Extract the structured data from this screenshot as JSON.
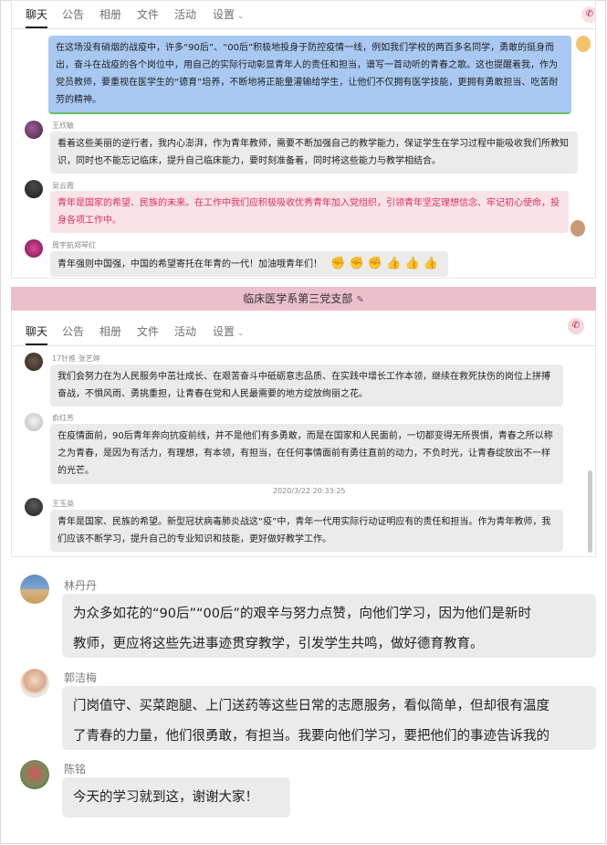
{
  "panel1": {
    "tabs": [
      "聊天",
      "公告",
      "相册",
      "文件",
      "活动",
      "设置"
    ],
    "messages": [
      {
        "name": "",
        "text": "在这场没有硝烟的战疫中，许多“90后”、“00后”积极地投身于防控疫情一线，例如我们学校的两百多名同学，勇敢的挺身而出，奋斗在战疫的各个岗位中，用自己的实际行动彰显青年人的责任和担当，谱写一首动听的青春之歌。这也提醒着我，作为党员教师，要重视在医学生的“德育”培养，不断地将正能量灌输给学生，让他们不仅拥有医学技能，更拥有勇敢担当、吃苦耐劳的精神。"
      },
      {
        "name": "王欣敏",
        "text": "看着这些美丽的逆行者，我内心澎湃，作为青年教师，需要不断加强自己的教学能力，保证学生在学习过程中能吸收我们所教知识，同时也不能忘记临床，提升自己临床能力，要时刻准备着，同时将这些能力与教学相结合。"
      },
      {
        "name": "吴云霞",
        "text": "青年是国家的希望、民族的未来。在工作中我们应积极吸收优秀青年加入党组织，引领青年坚定理想信念、牢记初心使命，投身各项工作中。"
      },
      {
        "name": "周宇航郑琴红",
        "text": "青年强则中国强，中国的希望寄托在年青的一代！加油哦青年们！"
      }
    ]
  },
  "panel2": {
    "title": "临床医学系第三党支部",
    "tabs": [
      "聊天",
      "公告",
      "相册",
      "文件",
      "活动",
      "设置"
    ],
    "timestamp": "2020/3/22 20:33:25",
    "messages": [
      {
        "name": "17针推 张艺婷",
        "text": "我们会努力在为人民服务中茁壮成长、在艰苦奋斗中砥砺意志品质、在实践中增长工作本领，继续在救死扶伤的岗位上拼搏奋战，不惧风雨、勇挑重担，让青春在党和人民最需要的地方绽放绚丽之花。"
      },
      {
        "name": "俞红芳",
        "text": "在疫情面前，90后青年奔向抗疫前线，并不是他们有多勇敢，而是在国家和人民面前，一切都变得无所畏惧，青春之所以称之为青春，是因为有活力，有理想，有本领，有担当，在任何事情面前有勇往直前的动力，不负时光，让青春绽放出不一样的光芒。"
      },
      {
        "name": "王玉英",
        "text": "青年是国家、民族的希望。新型冠状病毒肺炎战这“疫”中，青年一代用实际行动证明应有的责任和担当。作为青年教师，我们应该不断学习，提升自己的专业知识和技能，更好做好教学工作。"
      }
    ]
  },
  "panel3": {
    "messages": [
      {
        "name": "林丹丹",
        "lines": [
          "为众多如花的“90后”“00后”的艰辛与努力点赞，向他们学习，因为他们是新时",
          "教师，更应将这些先进事迹贯穿教学，引发学生共鸣，做好德育教育。"
        ]
      },
      {
        "name": "郭洁梅",
        "lines": [
          "门岗值守、买菜跑腿、上门送药等这些日常的志愿服务，看似简单，但却很有温度",
          "了青春的力量，他们很勇敢，有担当。我要向他们学习，要把他们的事迹告诉我的"
        ]
      },
      {
        "name": "陈铭",
        "lines": [
          "今天的学习就到这，谢谢大家！"
        ]
      }
    ]
  },
  "icons": {
    "emoji": [
      "flexed-biceps",
      "flexed-biceps",
      "flexed-biceps",
      "thumbs-up",
      "thumbs-up",
      "thumbs-up"
    ],
    "phone": "phone-icon",
    "edit": "pencil-icon"
  }
}
